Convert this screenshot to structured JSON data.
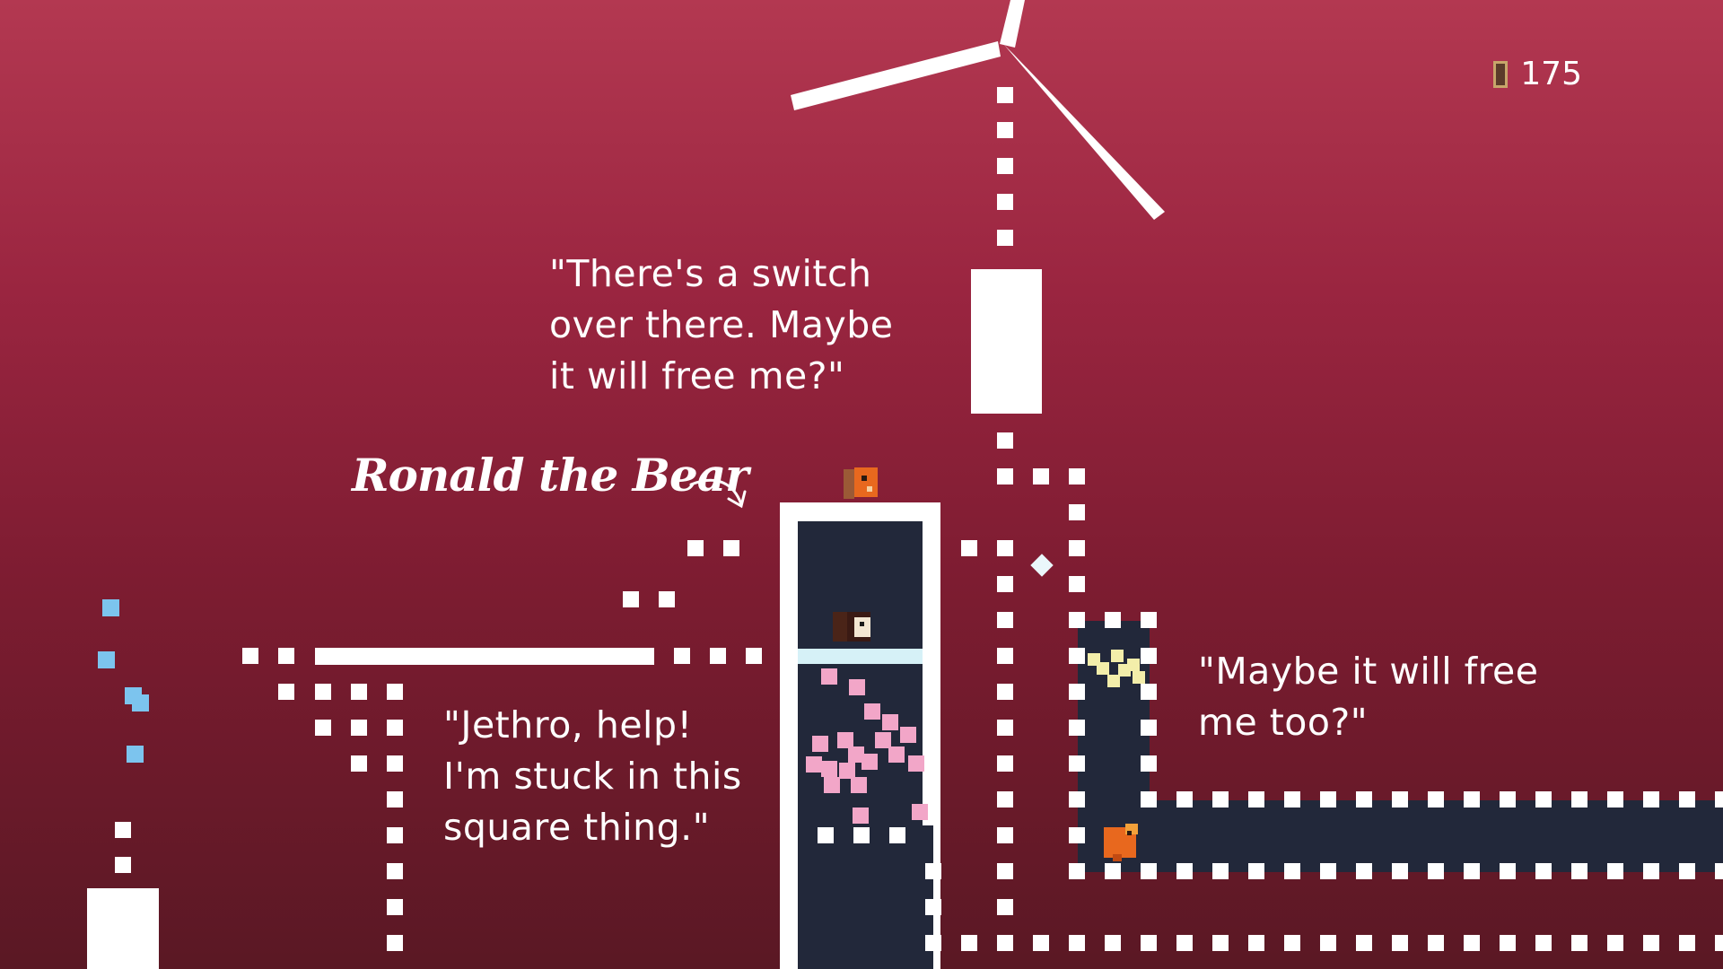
{
  "hud": {
    "counter_icon": "door-token-icon",
    "counter_value": "175"
  },
  "dialogue": {
    "switch_line": "\"There's a switch\nover there. Maybe\nit will free me?\"",
    "stuck_line": "\"Jethro, help!\nI'm stuck in this\nsquare thing.\"",
    "free_too_line": "\"Maybe it will free\nme too?\""
  },
  "labels": {
    "character_name": "Ronald the Bear"
  },
  "colors": {
    "background_top": "#b33851",
    "background_bottom": "#5a1824",
    "block_white": "#ffffff",
    "pit_navy": "#22283a",
    "light_blue": "#7cc4ee",
    "pink_particles": "#f2a6c8",
    "yellow_particles": "#f3eeaa",
    "orange_creature": "#e8681e"
  },
  "characters": [
    "ronald-the-bear",
    "jethro",
    "caged-creature",
    "orange-creature"
  ]
}
